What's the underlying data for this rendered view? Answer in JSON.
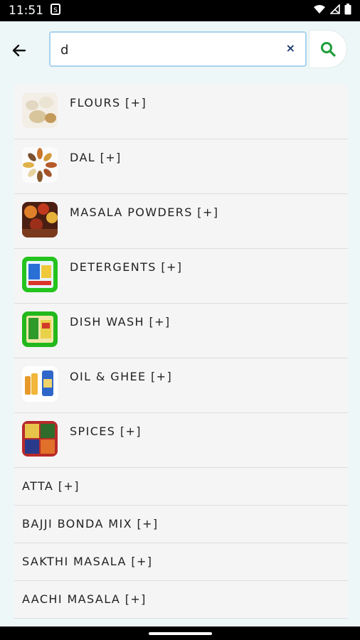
{
  "status": {
    "time": "11:51"
  },
  "search": {
    "value": "d",
    "clear_symbol": "×"
  },
  "colors": {
    "search_border": "#a9d2ee",
    "search_icon": "#1f9d3a",
    "background": "#eef7f7"
  },
  "categories_with_images": [
    {
      "label": "FLOURS [+]",
      "icon": "flour-image"
    },
    {
      "label": "DAL [+]",
      "icon": "dal-image"
    },
    {
      "label": "MASALA POWDERS [+]",
      "icon": "masala-image"
    },
    {
      "label": "DETERGENTS [+]",
      "icon": "detergent-image"
    },
    {
      "label": "DISH WASH [+]",
      "icon": "dishwash-image"
    },
    {
      "label": "OIL & GHEE [+]",
      "icon": "oil-ghee-image"
    },
    {
      "label": "SPICES [+]",
      "icon": "spices-image"
    }
  ],
  "categories_text": [
    {
      "label": "ATTA [+]"
    },
    {
      "label": "BAJJI BONDA MIX [+]"
    },
    {
      "label": "SAKTHI MASALA [+]"
    },
    {
      "label": "AACHI MASALA [+]"
    }
  ]
}
